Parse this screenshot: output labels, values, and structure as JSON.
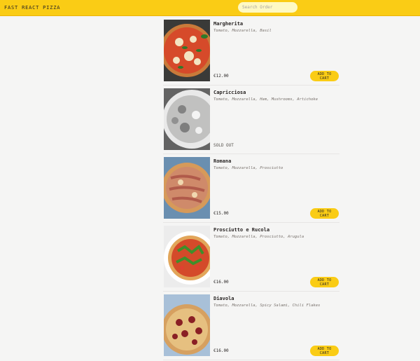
{
  "header": {
    "logo": "FAST REACT PIZZA",
    "search_placeholder": "Search Order"
  },
  "menu": [
    {
      "name": "Margherita",
      "ingredients": "Tomato, Mozzarella, Basil",
      "price": "€12.00",
      "sold_out": false,
      "button_label": "ADD TO CART"
    },
    {
      "name": "Capricciosa",
      "ingredients": "Tomato, Mozzarella, Ham, Mushrooms, Artichoke",
      "status": "SOLD OUT",
      "sold_out": true
    },
    {
      "name": "Romana",
      "ingredients": "Tomato, Mozzarella, Prosciutto",
      "price": "€15.00",
      "sold_out": false,
      "button_label": "ADD TO CART"
    },
    {
      "name": "Prosciutto e Rucola",
      "ingredients": "Tomato, Mozzarella, Prosciutto, Arugula",
      "price": "€16.00",
      "sold_out": false,
      "button_label": "ADD TO CART"
    },
    {
      "name": "Diavola",
      "ingredients": "Tomato, Mozzarella, Spicy Salami, Chili Flakes",
      "price": "€16.00",
      "sold_out": false,
      "button_label": "ADD TO CART"
    }
  ],
  "colors": {
    "accent": "#facc15",
    "background": "#f5f5f4"
  }
}
